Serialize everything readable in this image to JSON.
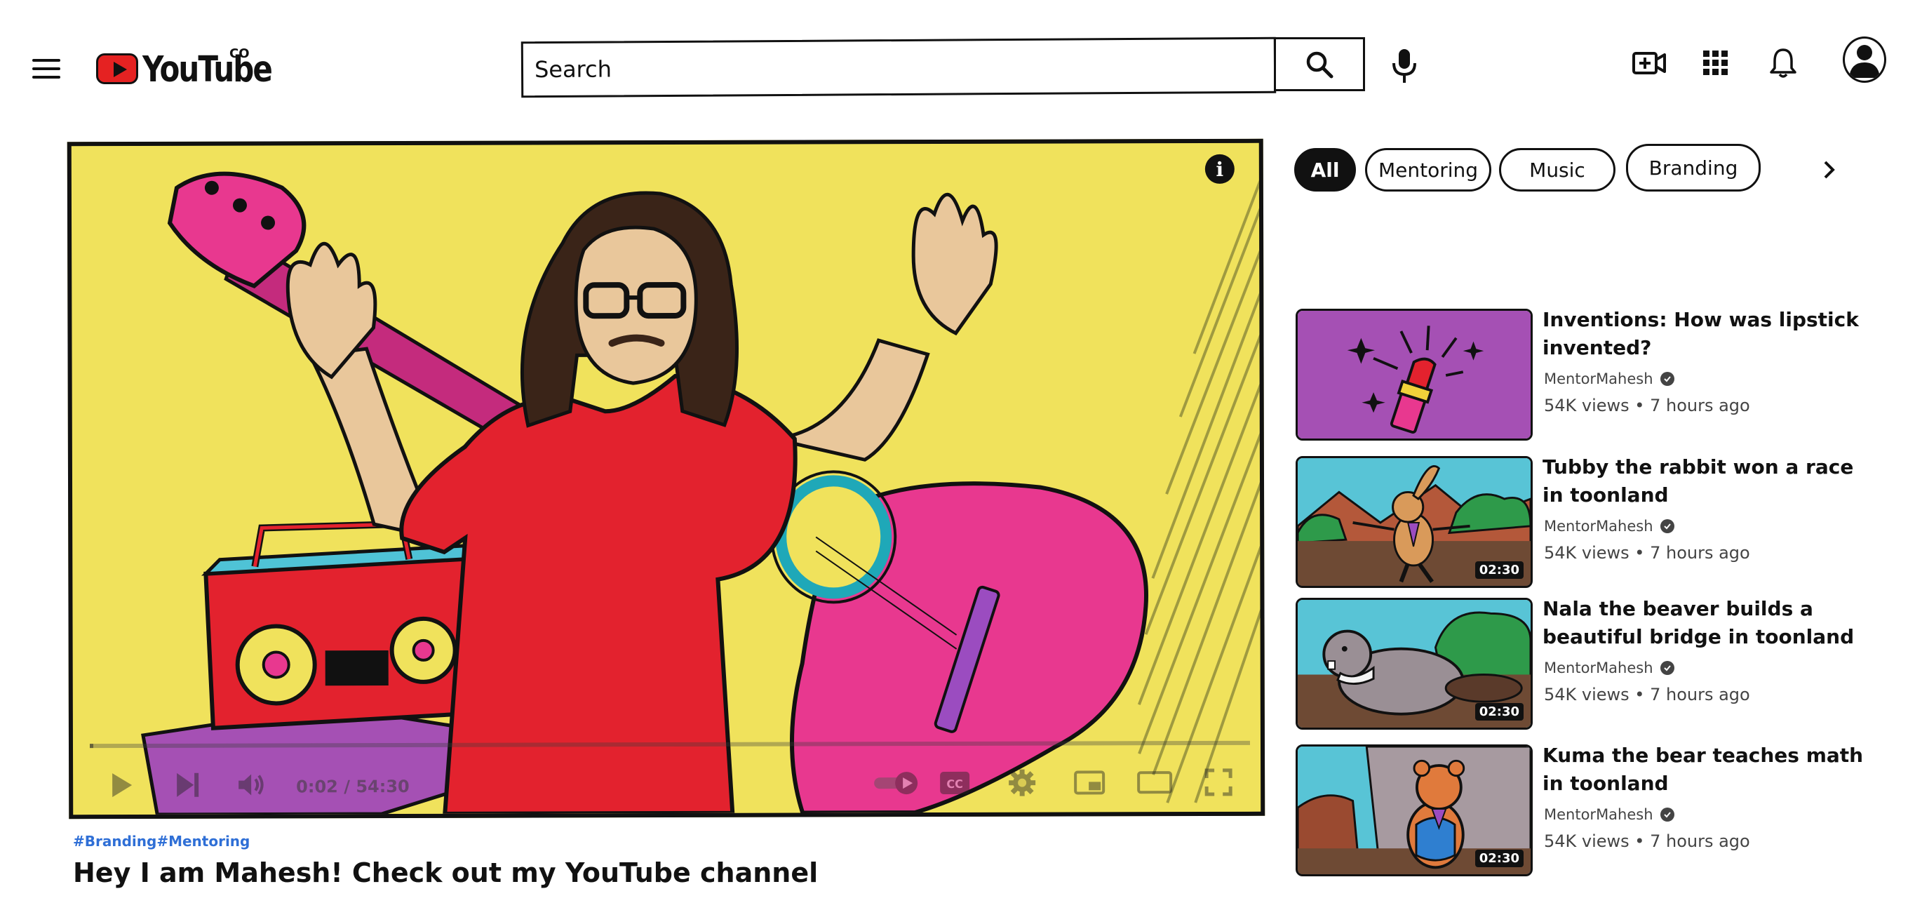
{
  "header": {
    "logo_text": "YouTube",
    "logo_superscript": "CO",
    "search_placeholder": "Search"
  },
  "icons": {
    "menu": "hamburger-icon",
    "search": "search-icon",
    "mic": "mic-icon",
    "create": "video-plus-icon",
    "apps": "apps-grid-icon",
    "notifications": "bell-icon",
    "account": "account-icon"
  },
  "player": {
    "time": "0:02 / 54:30",
    "progress_fraction": 0.0006,
    "info_glyph": "i",
    "cc_label": "CC"
  },
  "video": {
    "hashtags": [
      "#Branding",
      "#Mentoring"
    ],
    "title": "Hey I am Mahesh! Check out my YouTube channel"
  },
  "chips": [
    {
      "label": "All",
      "active": true
    },
    {
      "label": "Mentoring",
      "active": false
    },
    {
      "label": "Music",
      "active": false
    },
    {
      "label": "Branding",
      "active": false
    }
  ],
  "recommendations": [
    {
      "title": "Inventions: How was lipstick invented?",
      "channel": "MentorMahesh",
      "meta": "54K views • 7 hours ago",
      "duration": ""
    },
    {
      "title": "Tubby the rabbit won a race in toonland",
      "channel": "MentorMahesh",
      "meta": "54K views • 7 hours ago",
      "duration": "02:30"
    },
    {
      "title": "Nala the beaver builds a beautiful bridge in toonland",
      "channel": "MentorMahesh",
      "meta": "54K views • 7 hours ago",
      "duration": "02:30"
    },
    {
      "title": "Kuma the bear teaches math in toonland",
      "channel": "MentorMahesh",
      "meta": "54K views • 7 hours ago",
      "duration": "02:30"
    }
  ],
  "colors": {
    "player_bg": "#f0e25c",
    "brand_red": "#e52222",
    "hashtag_blue": "#2f6fd6",
    "guitar_pink": "#e8388f",
    "shirt_red": "#e3222e",
    "thumb_purple": "#a550b4"
  }
}
